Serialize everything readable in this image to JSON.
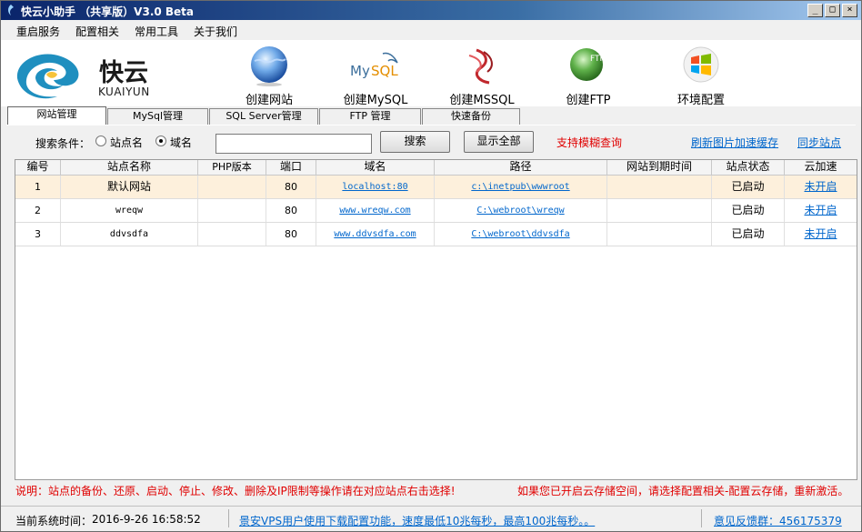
{
  "window": {
    "title": "快云小助手 （共享版）V3.0 Beta",
    "minimize": "_",
    "maximize": "□",
    "close": "×"
  },
  "menu": [
    "重启服务",
    "配置相关",
    "常用工具",
    "关于我们"
  ],
  "logo": {
    "cn": "快云",
    "en": "KUAIYUN"
  },
  "toolbar": [
    {
      "label": "创建网站",
      "icon": "globe-icon"
    },
    {
      "label": "创建MySQL",
      "icon": "mysql-icon"
    },
    {
      "label": "创建MSSQL",
      "icon": "mssql-icon"
    },
    {
      "label": "创建FTP",
      "icon": "ftp-icon"
    },
    {
      "label": "环境配置",
      "icon": "windows-icon"
    }
  ],
  "tabs": [
    "网站管理",
    "MySql管理",
    "SQL Server管理",
    "FTP 管理",
    "快速备份"
  ],
  "search": {
    "label": "搜索条件：",
    "option_site": "站点名",
    "option_domain": "域名",
    "selected": "域名",
    "value": "",
    "search_btn": "搜索",
    "show_all_btn": "显示全部",
    "fuzzy_hint": "支持模糊查询",
    "refresh_link": "刷新图片加速缓存",
    "sync_link": "同步站点"
  },
  "table": {
    "columns": [
      "编号",
      "站点名称",
      "PHP版本",
      "端口",
      "域名",
      "路径",
      "网站到期时间",
      "站点状态",
      "云加速"
    ],
    "rows": [
      {
        "id": "1",
        "name": "默认网站",
        "php": "",
        "port": "80",
        "domain": "localhost:80",
        "path": "c:\\inetpub\\wwwroot",
        "expire": "",
        "status": "已启动",
        "cdn": "未开启"
      },
      {
        "id": "2",
        "name": "wreqw",
        "php": "",
        "port": "80",
        "domain": "www.wreqw.com",
        "path": "C:\\webroot\\wreqw",
        "expire": "",
        "status": "已启动",
        "cdn": "未开启"
      },
      {
        "id": "3",
        "name": "ddvsdfa",
        "php": "",
        "port": "80",
        "domain": "www.ddvsdfa.com",
        "path": "C:\\webroot\\ddvsdfa",
        "expire": "",
        "status": "已启动",
        "cdn": "未开启"
      }
    ]
  },
  "notes": {
    "left": "说明：站点的备份、还原、启动、停止、修改、删除及IP限制等操作请在对应站点右击选择!",
    "right": "如果您已开启云存储空间，请选择配置相关-配置云存储，重新激活。"
  },
  "status": {
    "time_label": "当前系统时间：",
    "time_value": "2016-9-26 16:58:52",
    "promo": "景安VPS用户使用下载配置功能，速度最低10兆每秒，最高100兆每秒。。",
    "feedback": "意见反馈群：456175379"
  },
  "colors": {
    "accent_red": "#e00000",
    "link_blue": "#0066cc",
    "selected_row": "#fdf0dc"
  }
}
